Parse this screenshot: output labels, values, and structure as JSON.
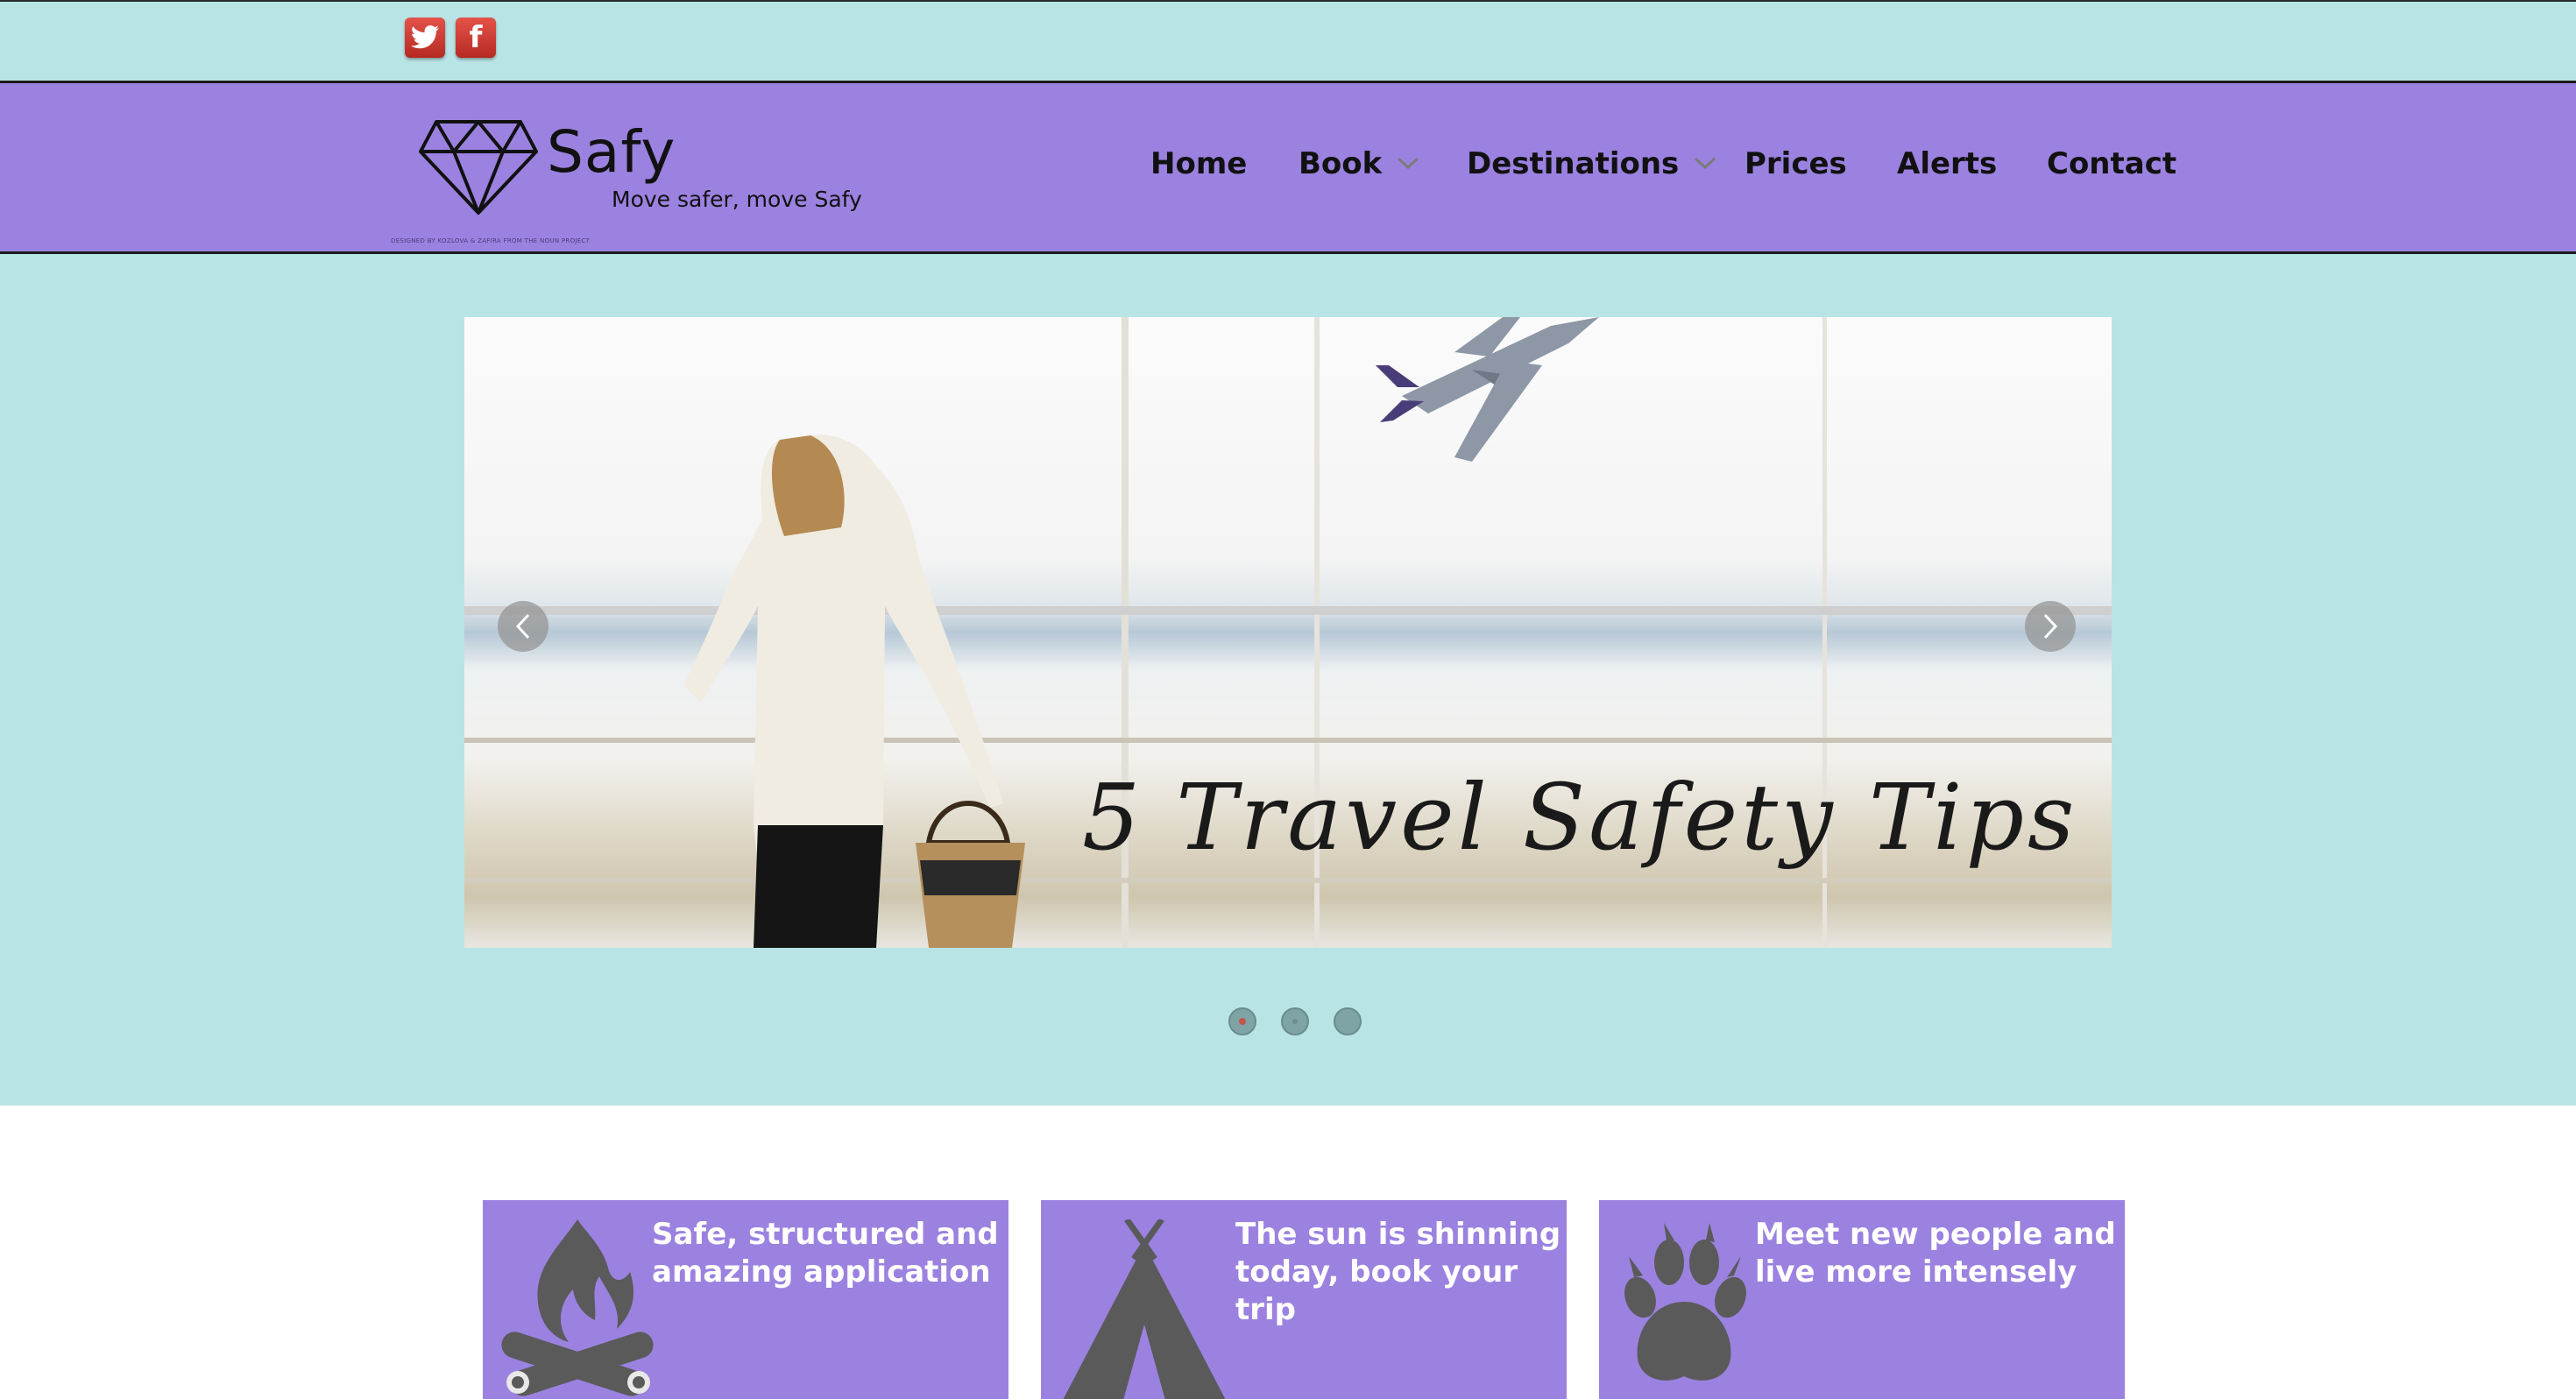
{
  "social": {
    "twitter_icon": "twitter-icon",
    "facebook_icon": "facebook-icon",
    "facebook_glyph": "f"
  },
  "brand": {
    "name": "Safy",
    "tagline": "Move safer, move Safy",
    "credit": "DESIGNED BY KOZLOVA & ZAFIRA FROM THE NOUN PROJECT",
    "logo_icon": "diamond-icon"
  },
  "nav": {
    "items": [
      {
        "label": "Home",
        "has_dropdown": false
      },
      {
        "label": "Book",
        "has_dropdown": true
      },
      {
        "label": "Destinations",
        "has_dropdown": true
      },
      {
        "label": "Prices",
        "has_dropdown": false
      },
      {
        "label": "Alerts",
        "has_dropdown": false
      },
      {
        "label": "Contact",
        "has_dropdown": false
      }
    ]
  },
  "slider": {
    "caption": "5 Travel Safety Tips",
    "prev_icon": "chevron-left-icon",
    "next_icon": "chevron-right-icon",
    "slide_count": 3,
    "active_slide": 1
  },
  "features": [
    {
      "text_line1": "Safe, structured and",
      "text_line2": "amazing application",
      "icon": "campfire-icon"
    },
    {
      "text_line1": "The sun is shinning",
      "text_line2": "today, book your trip",
      "icon": "tent-icon"
    },
    {
      "text_line1": "Meet new people and",
      "text_line2": "live more intensely",
      "icon": "paw-icon"
    }
  ],
  "colors": {
    "topbar_bg": "#b8e4e6",
    "header_bg": "#9b82e0",
    "tile_bg": "#9b82e0",
    "icon_gray": "#5a5a5a",
    "social_red": "#c93a30"
  }
}
